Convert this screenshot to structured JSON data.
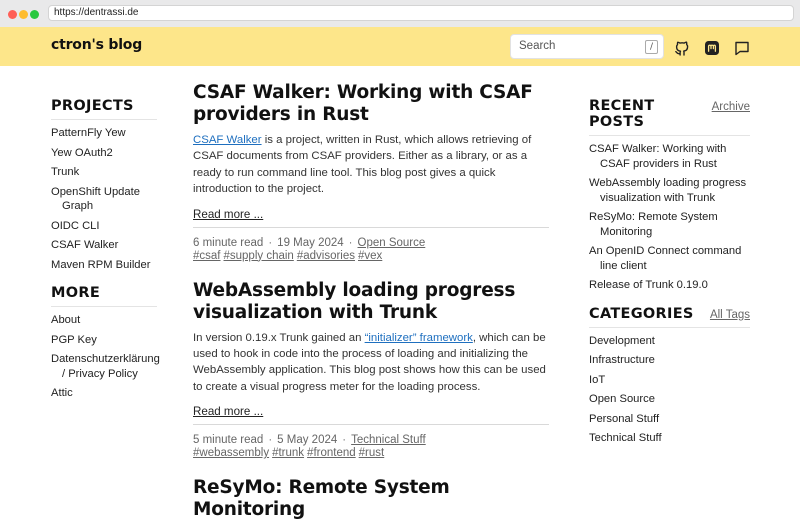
{
  "browser": {
    "url": "https://dentrassi.de"
  },
  "header": {
    "brand": "ctron's blog",
    "search_label": "Search",
    "search_shortcut": "/",
    "icons": [
      "github-icon",
      "mastodon-icon",
      "chat-icon"
    ]
  },
  "projects": {
    "title": "PROJECTS",
    "items": [
      "PatternFly Yew",
      "Yew OAuth2",
      "Trunk",
      "OpenShift Update Graph",
      "OIDC CLI",
      "CSAF Walker",
      "Maven RPM Builder"
    ]
  },
  "more": {
    "title": "MORE",
    "items": [
      "About",
      "PGP Key",
      "Datenschutzerklärung / Privacy Policy",
      "Attic"
    ]
  },
  "posts": [
    {
      "title": "CSAF Walker: Working with CSAF providers in Rust",
      "excerpt_link": "CSAF Walker",
      "excerpt_text": " is a project, written in Rust, which allows retrieving of CSAF documents from CSAF providers. Either as a library, or as a ready to run command line tool. This blog post gives a quick introduction to the project.",
      "read_more": "Read more ...",
      "read_time": "6 minute read",
      "date": "19 May 2024",
      "category": "Open Source",
      "tags": [
        "#csaf",
        "#supply chain",
        "#advisories",
        "#vex"
      ]
    },
    {
      "title": "WebAssembly loading progress visualization with Trunk",
      "excerpt_before": "In version 0.19.x Trunk gained an ",
      "excerpt_link": "“initializer” framework",
      "excerpt_after": ", which can be used to hook in code into the process of loading and initializing the WebAssembly application. This blog post shows how this can be used to create a visual progress meter for the loading process.",
      "read_more": "Read more ...",
      "read_time": "5 minute read",
      "date": "5 May 2024",
      "category": "Technical Stuff",
      "tags": [
        "#webassembly",
        "#trunk",
        "#frontend",
        "#rust"
      ]
    },
    {
      "title": "ReSyMo: Remote System Monitoring"
    }
  ],
  "recent": {
    "title": "RECENT POSTS",
    "archive_label": "Archive",
    "items": [
      "CSAF Walker: Working with CSAF providers in Rust",
      "WebAssembly loading progress visualization with Trunk",
      "ReSyMo: Remote System Monitoring",
      "An OpenID Connect command line client",
      "Release of Trunk 0.19.0"
    ]
  },
  "categories": {
    "title": "CATEGORIES",
    "all_tags_label": "All Tags",
    "items": [
      "Development",
      "Infrastructure",
      "IoT",
      "Open Source",
      "Personal Stuff",
      "Technical Stuff"
    ]
  },
  "colors": {
    "header_bg": "#fde68a",
    "link": "#1e6fbf"
  }
}
